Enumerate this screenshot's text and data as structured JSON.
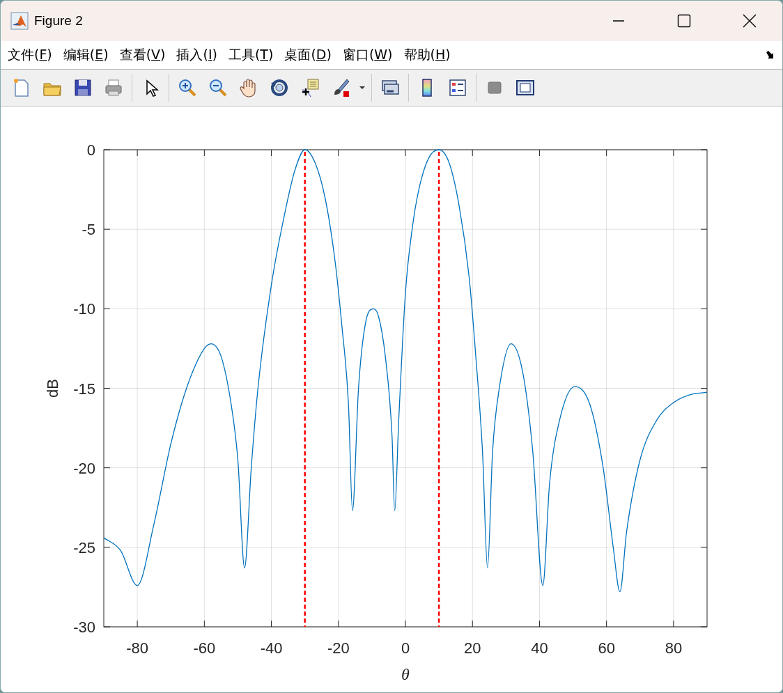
{
  "window": {
    "title": "Figure 2"
  },
  "menu": [
    {
      "label": "文件(F)"
    },
    {
      "label": "编辑(E)"
    },
    {
      "label": "查看(V)"
    },
    {
      "label": "插入(I)"
    },
    {
      "label": "工具(T)"
    },
    {
      "label": "桌面(D)"
    },
    {
      "label": "窗口(W)"
    },
    {
      "label": "帮助(H)"
    }
  ],
  "figure": {
    "chart_data": {
      "type": "line",
      "xlabel": "θ",
      "ylabel": "dB",
      "xlim": [
        -90,
        90
      ],
      "ylim": [
        -30,
        0
      ],
      "xticks": [
        -80,
        -60,
        -40,
        -20,
        0,
        20,
        40,
        60,
        80
      ],
      "yticks": [
        0,
        -5,
        -10,
        -15,
        -20,
        -25,
        -30
      ],
      "x": [
        -90,
        -85,
        -80,
        -75,
        -70,
        -65,
        -60,
        -58,
        -55,
        -52,
        -50,
        -48,
        -46,
        -44,
        -40,
        -36,
        -33,
        -30,
        -27,
        -24,
        -21,
        -19,
        -17,
        -15.8,
        -14,
        -12,
        -9.5,
        -8,
        -6,
        -4,
        -3.2,
        -2,
        0,
        2,
        4,
        7,
        10,
        13,
        16,
        19,
        21,
        23,
        24.5,
        26,
        28,
        31.5,
        35,
        38,
        41,
        43,
        46,
        50.5,
        55,
        59,
        62,
        64,
        66,
        70,
        75,
        80,
        85,
        90
      ],
      "grid": true,
      "series": [
        {
          "color": "#0072bd",
          "values": [
            -24.4,
            -25.2,
            -27.4,
            -23.5,
            -18.5,
            -14.8,
            -12.5,
            -12.2,
            -13,
            -16,
            -19.5,
            -26.3,
            -20,
            -15,
            -8.5,
            -4,
            -1.3,
            0,
            -0.8,
            -3,
            -7,
            -11,
            -16,
            -22.7,
            -15,
            -11,
            -10,
            -10.5,
            -13,
            -18,
            -22.7,
            -17,
            -9,
            -5,
            -2.5,
            -0.5,
            0,
            -0.8,
            -3.5,
            -8,
            -13,
            -19,
            -26.3,
            -19,
            -15,
            -12.2,
            -14,
            -19,
            -27.4,
            -21,
            -17,
            -14.9,
            -16,
            -20,
            -25,
            -27.8,
            -24,
            -19.5,
            -17,
            -15.9,
            -15.4,
            -15.25
          ]
        }
      ],
      "ref_lines": [
        {
          "axis": "x",
          "value": -30,
          "color": "#ff0000"
        },
        {
          "axis": "x",
          "value": 10,
          "color": "#ff0000"
        }
      ]
    }
  }
}
